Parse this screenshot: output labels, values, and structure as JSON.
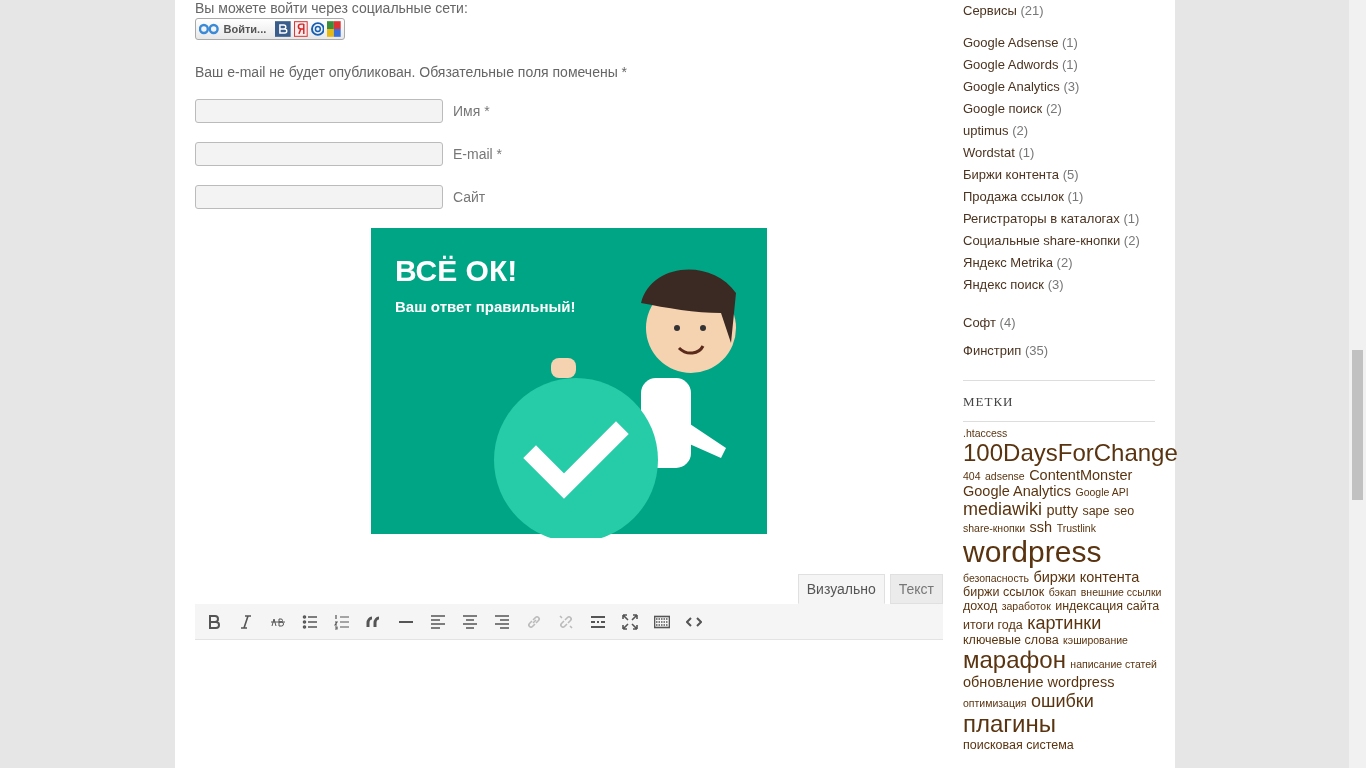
{
  "social_login": {
    "intro": "Вы можете войти через социальные сети:",
    "button_label": "Войти..."
  },
  "comment_form": {
    "notice": "Ваш e-mail не будет опубликован. Обязательные поля помечены *",
    "fields": [
      {
        "label": "Имя *"
      },
      {
        "label": "E-mail *"
      },
      {
        "label": "Сайт"
      }
    ]
  },
  "captcha_result": {
    "title": "ВСЁ ОК!",
    "subtitle": "Ваш ответ правильный!"
  },
  "editor": {
    "tabs": [
      {
        "label": "Визуально",
        "selected": true
      },
      {
        "label": "Текст",
        "selected": false
      }
    ],
    "toolbar": [
      {
        "kind": "bold",
        "disabled": false
      },
      {
        "kind": "italic",
        "disabled": false
      },
      {
        "kind": "strike",
        "disabled": false
      },
      {
        "kind": "bullets",
        "disabled": false
      },
      {
        "kind": "numbers",
        "disabled": false
      },
      {
        "kind": "quote",
        "disabled": false
      },
      {
        "kind": "hr",
        "disabled": false
      },
      {
        "kind": "alignleft",
        "disabled": false
      },
      {
        "kind": "aligncenter",
        "disabled": false
      },
      {
        "kind": "alignright",
        "disabled": false
      },
      {
        "kind": "link",
        "disabled": true
      },
      {
        "kind": "unlink",
        "disabled": true
      },
      {
        "kind": "more",
        "disabled": false
      },
      {
        "kind": "fullscreen",
        "disabled": false
      },
      {
        "kind": "keyboard",
        "disabled": false
      },
      {
        "kind": "code",
        "disabled": false
      }
    ]
  },
  "sidebar": {
    "categories": [
      {
        "name": "Сервисы",
        "count": "(21)",
        "children": [
          {
            "name": "Google Adsense",
            "count": "(1)"
          },
          {
            "name": "Google Adwords",
            "count": "(1)"
          },
          {
            "name": "Google Analytics",
            "count": "(3)"
          },
          {
            "name": "Google поиск",
            "count": "(2)"
          },
          {
            "name": "uptimus",
            "count": "(2)"
          },
          {
            "name": "Wordstat",
            "count": "(1)"
          },
          {
            "name": "Биржи контента",
            "count": "(5)"
          },
          {
            "name": "Продажа ссылок",
            "count": "(1)"
          },
          {
            "name": "Регистраторы в каталогах",
            "count": "(1)"
          },
          {
            "name": "Социальные share-кнопки",
            "count": "(2)"
          },
          {
            "name": "Яндекс Metrika",
            "count": "(2)"
          },
          {
            "name": "Яндекс поиск",
            "count": "(3)"
          }
        ]
      },
      {
        "name": "Софт",
        "count": "(4)"
      },
      {
        "name": "Финстрип",
        "count": "(35)"
      }
    ],
    "tags_title": "МЕТКИ",
    "tags": [
      {
        "text": ".htaccess",
        "kind": "xs"
      },
      {
        "text": "100DaysForChange",
        "kind": "xl"
      },
      {
        "text": "404",
        "kind": "xs"
      },
      {
        "text": "adsense",
        "kind": "xs"
      },
      {
        "text": "ContentMonster",
        "kind": "m"
      },
      {
        "text": "Google Analytics",
        "kind": "m"
      },
      {
        "text": "Google API",
        "kind": "xs"
      },
      {
        "text": "mediawiki",
        "kind": "l"
      },
      {
        "text": "putty",
        "kind": "m"
      },
      {
        "text": "sape",
        "kind": "s"
      },
      {
        "text": "seo",
        "kind": "s"
      },
      {
        "text": "share-кнопки",
        "kind": "xs"
      },
      {
        "text": "ssh",
        "kind": "m"
      },
      {
        "text": "Trustlink",
        "kind": "xs"
      },
      {
        "text": "wordpress",
        "kind": "xxl"
      },
      {
        "text": "безопасность",
        "kind": "xs"
      },
      {
        "text": "биржи контента",
        "kind": "m"
      },
      {
        "text": "биржи ссылок",
        "kind": "s"
      },
      {
        "text": "бэкап",
        "kind": "xs"
      },
      {
        "text": "внешние ссылки",
        "kind": "xs"
      },
      {
        "text": "доход",
        "kind": "s"
      },
      {
        "text": "заработок",
        "kind": "xs"
      },
      {
        "text": "индексация сайта",
        "kind": "s"
      },
      {
        "text": "итоги года",
        "kind": "s"
      },
      {
        "text": "картинки",
        "kind": "l"
      },
      {
        "text": "ключевые слова",
        "kind": "s"
      },
      {
        "text": "кэширование",
        "kind": "xs"
      },
      {
        "text": "марафон",
        "kind": "xl"
      },
      {
        "text": "написание статей",
        "kind": "xs"
      },
      {
        "text": "обновление wordpress",
        "kind": "m"
      },
      {
        "text": "оптимизация",
        "kind": "xs"
      },
      {
        "text": "ошибки",
        "kind": "l"
      },
      {
        "text": "плагины",
        "kind": "xl"
      },
      {
        "text": "поисковая система",
        "kind": "s"
      }
    ]
  }
}
